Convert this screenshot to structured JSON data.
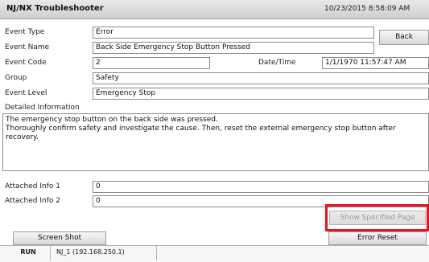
{
  "window": {
    "title": "NJ/NX Troubleshooter",
    "datetime": "10/23/2015 8:58:09 AM"
  },
  "buttons": {
    "back": "Back",
    "show_specified_page": "Show Specified Page",
    "screen_shot": "Screen Shot",
    "error_reset": "Error Reset"
  },
  "fields": {
    "event_type": {
      "label": "Event Type",
      "value": "Error"
    },
    "event_name": {
      "label": "Event Name",
      "value": "Back Side Emergency Stop Button Pressed"
    },
    "event_code": {
      "label": "Event Code",
      "value": "2"
    },
    "date_time": {
      "label": "Date/Time",
      "value": "1/1/1970 11:57:47 AM"
    },
    "group": {
      "label": "Group",
      "value": "Safety"
    },
    "event_level": {
      "label": "Event Level",
      "value": "Emergency Stop"
    },
    "detailed_information": {
      "label": "Detailed Information",
      "line1": "The emergency stop button on the back side was pressed.",
      "line2": "Thoroughly confirm safety and investigate the cause. Then, reset the external emergency stop button after recovery."
    },
    "attached_info_1": {
      "label": "Attached Info 1",
      "value": "0"
    },
    "attached_info_2": {
      "label": "Attached Info 2",
      "value": "0"
    }
  },
  "status_bar": {
    "mode": "RUN",
    "connection": "NJ_1 (192.168.250.1)"
  },
  "colors": {
    "highlight": "#e8131f"
  }
}
